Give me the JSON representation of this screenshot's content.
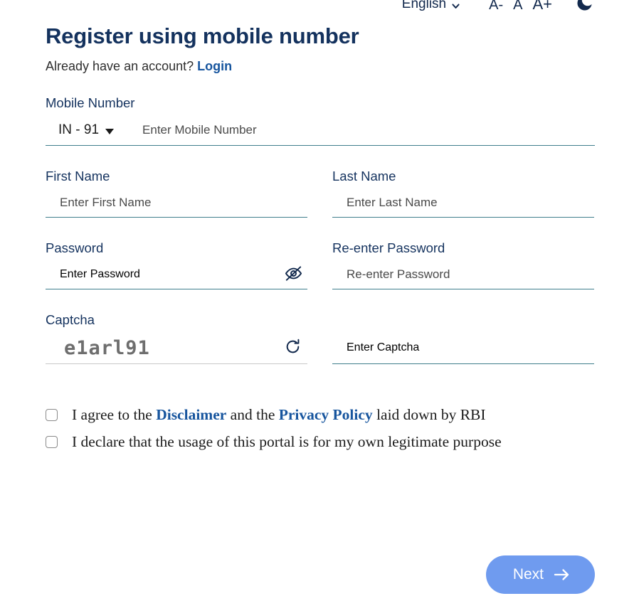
{
  "topbar": {
    "language": "English",
    "language_icon": "chevron-down-icon",
    "font_decrease": "A-",
    "font_normal": "A",
    "font_increase": "A+",
    "theme_icon": "moon-icon"
  },
  "header": {
    "title": "Register using mobile number",
    "already_text": "Already have an account? ",
    "login_link": "Login"
  },
  "form": {
    "mobile": {
      "label": "Mobile Number",
      "country_code": "IN - 91",
      "country_icon": "caret-down-icon",
      "placeholder": "Enter Mobile Number",
      "value": ""
    },
    "first_name": {
      "label": "First Name",
      "placeholder": "Enter First Name",
      "value": ""
    },
    "last_name": {
      "label": "Last Name",
      "placeholder": "Enter Last Name",
      "value": ""
    },
    "password": {
      "label": "Password",
      "placeholder": "Enter Password",
      "value": "",
      "toggle_icon": "eye-off-icon"
    },
    "reenter_password": {
      "label": "Re-enter Password",
      "placeholder": "Re-enter Password",
      "value": ""
    },
    "captcha": {
      "label": "Captcha",
      "code": "e1arl91",
      "refresh_icon": "refresh-icon",
      "input_placeholder": "Enter Captcha",
      "input_value": ""
    }
  },
  "consents": [
    {
      "checked": false,
      "parts": [
        {
          "text": "I agree to the ",
          "link": false
        },
        {
          "text": "Disclaimer",
          "link": true
        },
        {
          "text": " and the ",
          "link": false
        },
        {
          "text": "Privacy Policy",
          "link": true
        },
        {
          "text": " laid down by RBI",
          "link": false
        }
      ]
    },
    {
      "checked": false,
      "parts": [
        {
          "text": "I declare that the usage of this portal is for my own legitimate purpose",
          "link": false
        }
      ]
    }
  ],
  "footer": {
    "next_label": "Next",
    "next_icon": "arrow-right-icon"
  },
  "colors": {
    "title": "#14325e",
    "link": "#17559e",
    "underline": "#3f7e8c",
    "button": "#6f9bef",
    "captcha_text": "#6e6e6e"
  }
}
